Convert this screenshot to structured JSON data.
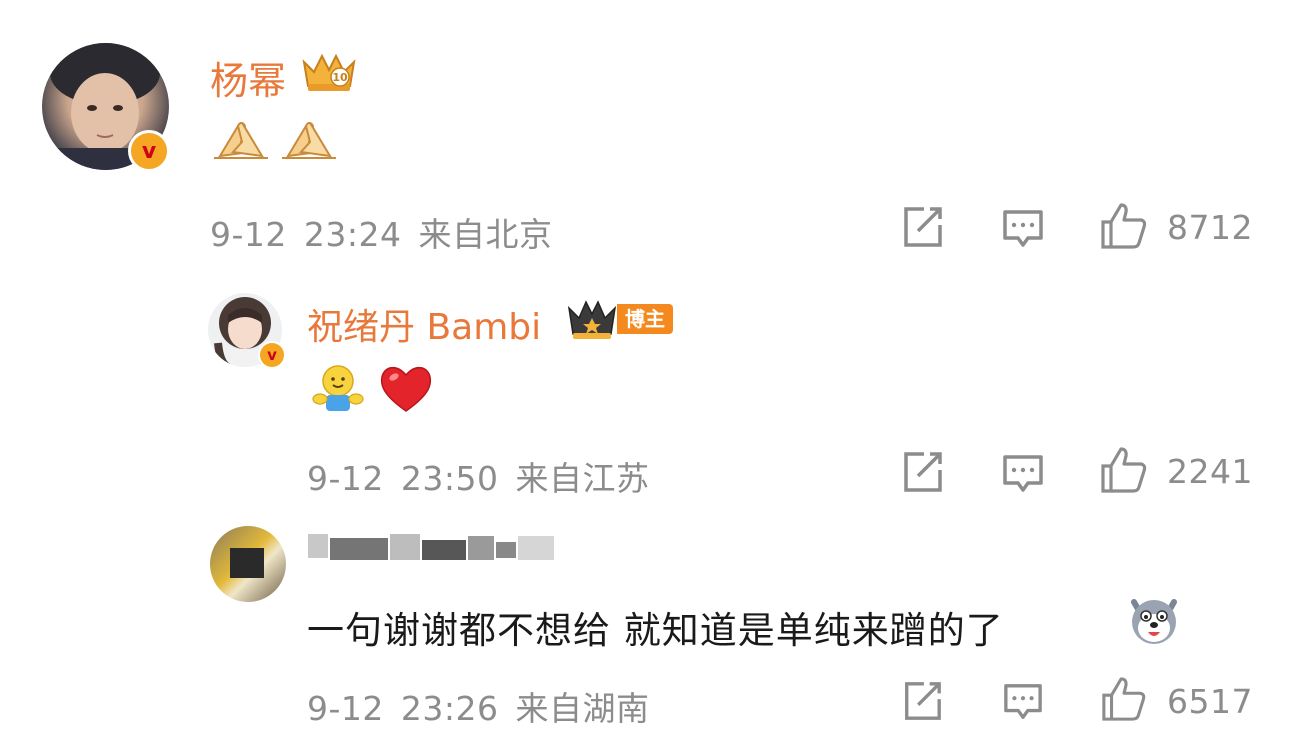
{
  "comments": [
    {
      "username": "杨幂",
      "level_badge": "10",
      "content_icons": [
        "pray-hands-icon",
        "pray-hands-icon"
      ],
      "date": "9-12",
      "time": "23:24",
      "location": "来自北京",
      "likes": "8712"
    },
    {
      "username": "祝绪丹 Bambi",
      "author_badge": "博主",
      "content_icons": [
        "hug-icon",
        "red-heart-icon"
      ],
      "date": "9-12",
      "time": "23:50",
      "location": "来自江苏",
      "likes": "2241"
    },
    {
      "username": "",
      "text": "一句谢谢都不想给 就知道是单纯来蹭的了",
      "content_icons": [
        "husky-emoji-icon"
      ],
      "date": "9-12",
      "time": "23:26",
      "location": "来自湖南",
      "likes": "6517"
    }
  ],
  "colors": {
    "username": "#e8793b",
    "meta": "#8c8c8c",
    "text": "#1a1a1a",
    "verify_badge": "#f5a623"
  }
}
